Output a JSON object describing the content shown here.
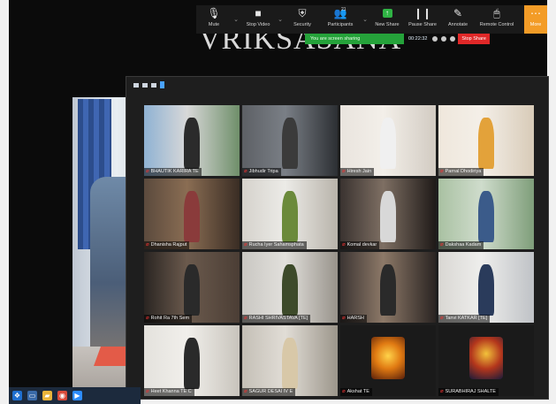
{
  "banner": {
    "text": "VRIKSASANA"
  },
  "toolbar": {
    "items": [
      {
        "label": "Mute",
        "icon": "🎙"
      },
      {
        "label": "Stop Video",
        "icon": "■"
      },
      {
        "label": "Security",
        "icon": "⛨"
      },
      {
        "label": "Participants",
        "icon": "👥",
        "count": "21"
      },
      {
        "label": "New Share",
        "icon": "↑"
      },
      {
        "label": "Pause Share",
        "icon": "❙❙"
      },
      {
        "label": "Annotate",
        "icon": "✎"
      },
      {
        "label": "Remote Control",
        "icon": "🖱"
      }
    ],
    "more_label": "More",
    "more_icon": "⋯"
  },
  "share_status": {
    "text": "You are screen sharing",
    "time": "00:22:32",
    "stop_label": "Stop Share"
  },
  "gallery": {
    "participants": [
      {
        "name": "BHAUTIK KARIRA TE"
      },
      {
        "name": "Jibhudir Tripa"
      },
      {
        "name": "Hiresh Jain"
      },
      {
        "name": "Parnal Dhodiriya"
      },
      {
        "name": "Dhanisha Rajput"
      },
      {
        "name": "Rucha Iyer Sahamsphata"
      },
      {
        "name": "Komal devkar"
      },
      {
        "name": "Dakshaa Kadam"
      },
      {
        "name": "Rohit Ra 7th Sem"
      },
      {
        "name": "RASHI SHRIVASTAVA [TE]"
      },
      {
        "name": "HARSH"
      },
      {
        "name": "Tanvi KATKAR [TE]"
      },
      {
        "name": "Heet Khanna TE C"
      },
      {
        "name": "SAGUR DESAI IV E"
      },
      {
        "name": "Akshat TE"
      },
      {
        "name": "SURABHIRAJ SHALTE"
      }
    ]
  },
  "colors": {
    "accent_orange": "#f39c27",
    "share_green": "#25a23a",
    "stop_red": "#e02828",
    "active_speaker": "#f0d02a"
  }
}
